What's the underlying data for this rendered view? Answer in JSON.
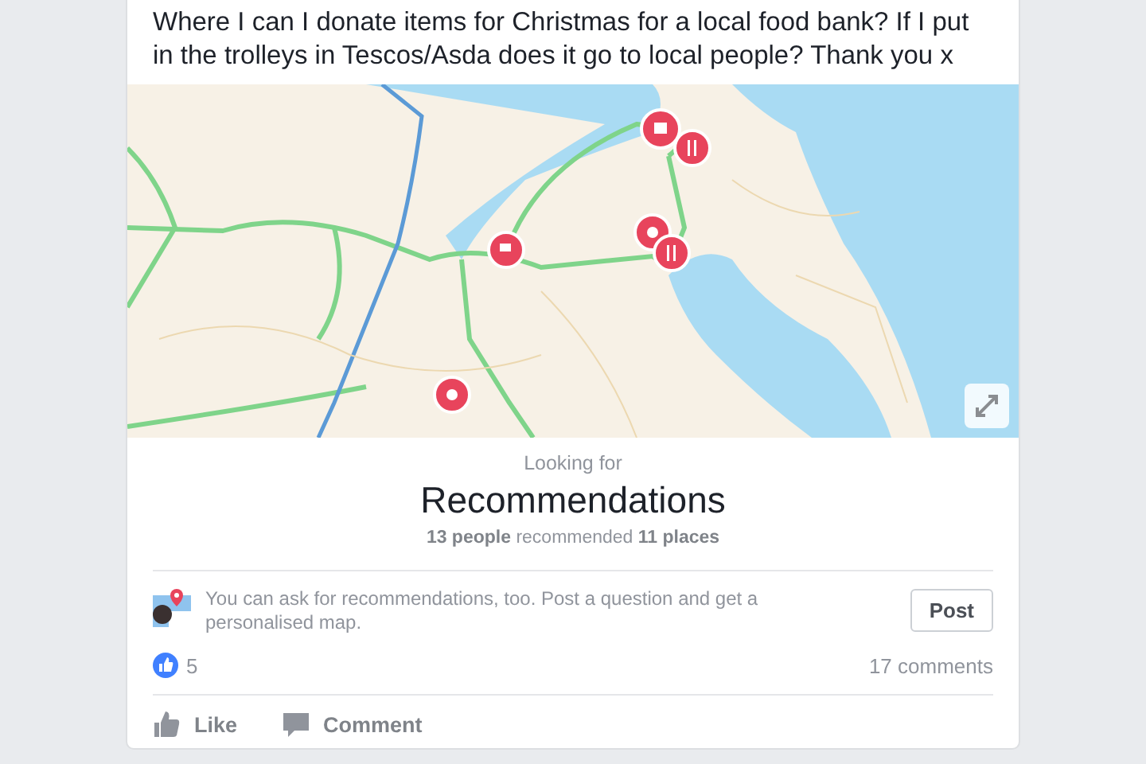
{
  "post": {
    "text": "Where I can I donate items for Christmas for a local food bank? If I put in the trolleys in Tescos/Asda does it go to local people? Thank you x"
  },
  "recommendations": {
    "heading": "Looking for",
    "title": "Recommendations",
    "summary": "**13 people** recommended **11 places**"
  },
  "prompt": {
    "text": "You can ask for recommendations, too. Post a question and get a personalised map.",
    "button": "Post"
  },
  "stats": {
    "likes": "5",
    "comments": "17 comments"
  },
  "actions": [
    {
      "kind": "like",
      "label": "Like"
    },
    {
      "kind": "comment",
      "label": "Comment"
    }
  ]
}
